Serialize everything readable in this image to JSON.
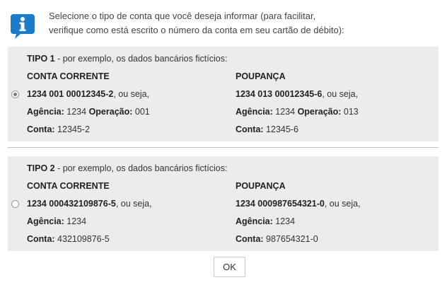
{
  "intro": {
    "line1": "Selecione o tipo de conta que você deseja informar (para facilitar,",
    "line2": "verifique como está escrito o número da conta em seu cartão de débito):"
  },
  "icon": "info-icon",
  "tipo1": {
    "label": "TIPO 1",
    "description": " - por exemplo, os dados bancários fictícios:",
    "selected": true,
    "corrente": {
      "title": "CONTA CORRENTE",
      "number": "1234 001 00012345-2",
      "suffix": ", ou seja,",
      "agencia_label": "Agência:",
      "agencia_value": " 1234 ",
      "operacao_label": "Operação:",
      "operacao_value": " 001",
      "conta_label": "Conta:",
      "conta_value": " 12345-2"
    },
    "poupanca": {
      "title": "POUPANÇA",
      "number": "1234 013 00012345-6",
      "suffix": ", ou seja,",
      "agencia_label": "Agência:",
      "agencia_value": " 1234 ",
      "operacao_label": "Operação:",
      "operacao_value": " 013",
      "conta_label": "Conta:",
      "conta_value": " 12345-6"
    }
  },
  "tipo2": {
    "label": "TIPO 2",
    "description": " - por exemplo, os dados bancários fictícios:",
    "selected": false,
    "corrente": {
      "title": "CONTA CORRENTE",
      "number": "1234 000432109876-5",
      "suffix": ", ou seja,",
      "agencia_label": "Agência:",
      "agencia_value": " 1234",
      "conta_label": "Conta:",
      "conta_value": " 432109876-5"
    },
    "poupanca": {
      "title": "POUPANÇA",
      "number": "1234 000987654321-0",
      "suffix": ", ou seja,",
      "agencia_label": "Agência:",
      "agencia_value": " 1234",
      "conta_label": "Conta:",
      "conta_value": " 987654321-0"
    }
  },
  "ok_label": "OK",
  "colors": {
    "icon_blue": "#1e7bc8",
    "panel_bg": "#ececec",
    "divider": "#b9c2cc"
  }
}
